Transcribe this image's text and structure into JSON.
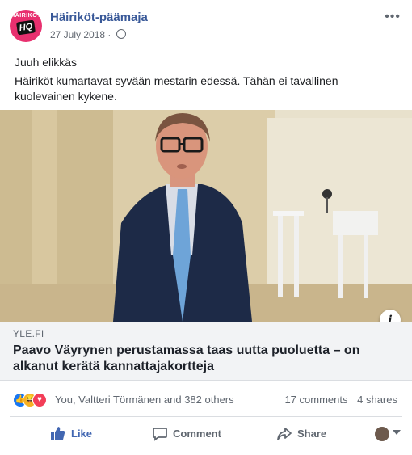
{
  "post": {
    "page_name": "Häiriköt-päämaja",
    "date": "27 July 2018",
    "avatar_top_text": "HÄIRIKÖT",
    "avatar_mid_text": "HQ",
    "text_line1": "Juuh elikkäs",
    "text_line2": "Häiriköt kumartavat syvään mestarin edessä. Tähän ei tavallinen kuolevainen kykene."
  },
  "link": {
    "domain": "YLE.FI",
    "headline": "Paavo Väyrynen perustamassa taas uutta puoluetta – on alkanut kerätä kannattajakortteja"
  },
  "engagement": {
    "reaction_names": "You, Valtteri Törmänen and 382 others",
    "comments": "17 comments",
    "shares": "4 shares"
  },
  "actions": {
    "like": "Like",
    "comment": "Comment",
    "share": "Share"
  },
  "icons": {
    "more": "more-options-icon",
    "globe": "globe-icon",
    "info": "info-icon"
  },
  "colors": {
    "brand_blue": "#385898",
    "like_blue": "#4267b2",
    "avatar_pink": "#e8306f"
  }
}
